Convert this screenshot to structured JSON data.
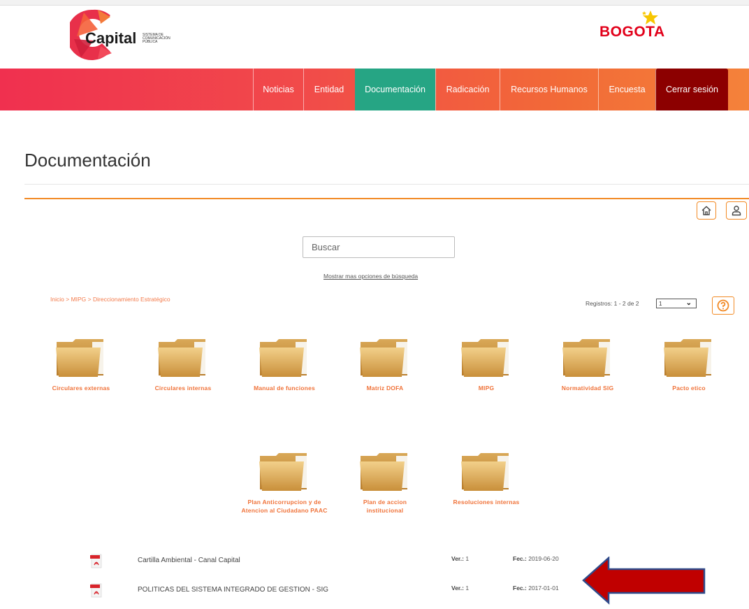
{
  "header": {
    "logo_left": "Capital",
    "logo_left_subtitle": "SISTEMA DE COMUNICACIÓN PÚBLICA",
    "logo_right": "BOGOTA"
  },
  "nav": {
    "items": [
      {
        "label": "Noticias"
      },
      {
        "label": "Entidad"
      },
      {
        "label": "Documentación"
      },
      {
        "label": "Radicación"
      },
      {
        "label": "Recursos Humanos"
      },
      {
        "label": "Encuesta"
      },
      {
        "label": "Cerrar sesión"
      }
    ],
    "active": "Documentación"
  },
  "page": {
    "title": "Documentación"
  },
  "toolbar": {
    "home_icon": "home-icon",
    "user_icon": "user-icon"
  },
  "search": {
    "placeholder": "Buscar",
    "more_options": "Mostrar mas opciones de búsqueda"
  },
  "breadcrumb": {
    "items": [
      "Inicio",
      "MIPG",
      "Direccionamiento Estratégico"
    ],
    "separator": ">"
  },
  "pagination": {
    "label": "Registros: 1 - 2 de 2",
    "page_value": "1"
  },
  "folders": [
    {
      "label": "Circulares externas"
    },
    {
      "label": "Circulares internas"
    },
    {
      "label": "Manual de funciones"
    },
    {
      "label": "Matriz DOFA"
    },
    {
      "label": "MIPG"
    },
    {
      "label": "Normatividad SIG"
    },
    {
      "label": "Pacto etico"
    },
    {
      "label": "Plan Anticorrupcion y de Atencion al Ciudadano PAAC"
    },
    {
      "label": "Plan de accion institucional"
    },
    {
      "label": "Resoluciones internas"
    }
  ],
  "documents": [
    {
      "name": "Cartilla Ambiental - Canal Capital",
      "ver_label": "Ver.:",
      "ver": "1",
      "fec_label": "Fec.:",
      "fec": "2019-06-20"
    },
    {
      "name": "POLITICAS DEL SISTEMA INTEGRADO DE GESTION - SIG",
      "ver_label": "Ver.:",
      "ver": "1",
      "fec_label": "Fec.:",
      "fec": "2017-01-01"
    }
  ],
  "colors": {
    "accent_orange": "#f28a25",
    "nav_active": "#26a584",
    "logout": "#8c0000",
    "arrow": "#c00000"
  }
}
